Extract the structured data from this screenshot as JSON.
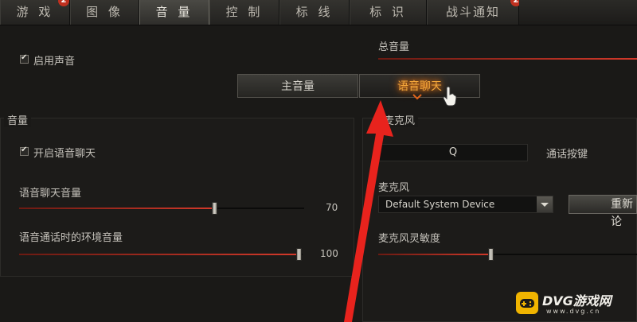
{
  "tabs": [
    {
      "label": "游 戏",
      "badge": "2"
    },
    {
      "label": "图 像",
      "badge": ""
    },
    {
      "label": "音 量",
      "badge": ""
    },
    {
      "label": "控 制",
      "badge": ""
    },
    {
      "label": "标 线",
      "badge": ""
    },
    {
      "label": "标 识",
      "badge": ""
    },
    {
      "label": "战斗通知",
      "badge": "2"
    }
  ],
  "enable_sound": {
    "label": "启用声音",
    "checked": true
  },
  "master_volume": {
    "label": "总音量",
    "value": 1.0
  },
  "subtabs": {
    "main": "主音量",
    "voice": "语音聊天"
  },
  "volume_panel": {
    "title": "音量",
    "enable_voice": {
      "label": "开启语音聊天",
      "checked": true
    },
    "voice_volume": {
      "label": "语音聊天音量",
      "value": "70",
      "level": 0.7
    },
    "ambient_volume": {
      "label": "语音通话时的环境音量",
      "value": "100",
      "level": 1.0
    }
  },
  "mic_panel": {
    "title": "麦克风",
    "ptt_key": "Q",
    "ptt_label": "通话按键",
    "device_label": "麦克风",
    "device_value": "Default System Device",
    "refresh_button": "重新论",
    "sensitivity_label": "麦克风灵敏度",
    "sensitivity_level": 0.44
  },
  "watermark": {
    "text": "DVG游戏网",
    "url": "www.dvg.cn"
  },
  "colors": {
    "accent": "#d3392a",
    "glow": "#ff8a1f",
    "background": "#1a1917"
  }
}
